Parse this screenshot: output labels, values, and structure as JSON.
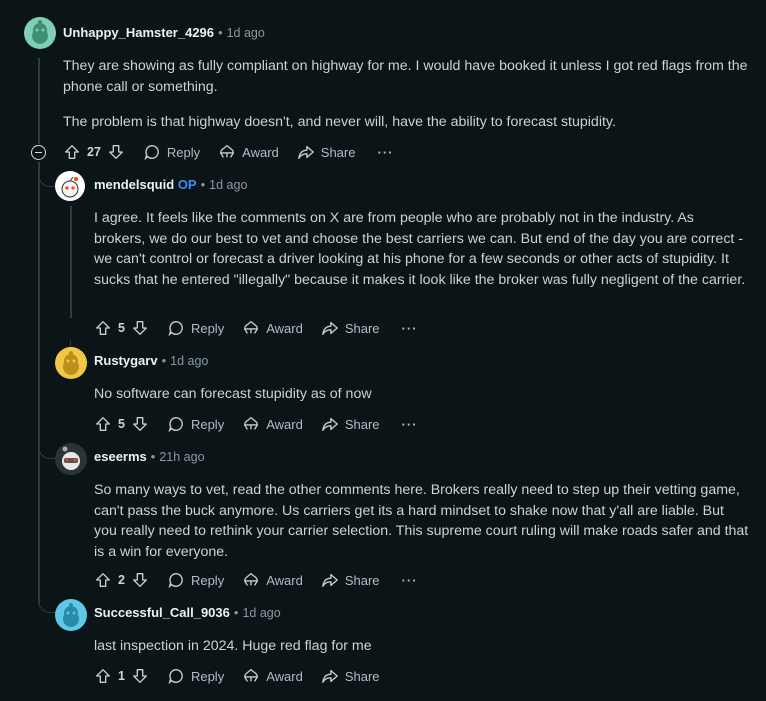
{
  "comments": [
    {
      "username": "Unhappy_Hamster_4296",
      "op": "",
      "time": "1d ago",
      "paragraphs": [
        "They are showing as fully compliant on highway for me. I would have booked it unless I got red flags from the phone call or something.",
        "The problem is that highway doesn't, and never will, have the ability to forecast stupidity."
      ],
      "votes": "27"
    },
    {
      "username": "mendelsquid",
      "op": "OP",
      "time": "1d ago",
      "paragraphs": [
        "I agree. It feels like the comments on X are from people who are probably not in the industry. As brokers, we do our best to vet and choose the best carriers we can. But end of the day you are correct - we can't control or forecast a driver looking at his phone for a few seconds or other acts of stupidity. It sucks that he entered \"illegally\" because it makes it look like the broker was fully negligent of the carrier."
      ],
      "votes": "5"
    },
    {
      "username": "Rustygarv",
      "op": "",
      "time": "1d ago",
      "paragraphs": [
        "No software can forecast stupidity as of now"
      ],
      "votes": "5"
    },
    {
      "username": "eseerms",
      "op": "",
      "time": "21h ago",
      "paragraphs": [
        "So many ways to vet, read the other comments here. Brokers really need to step up their vetting game, can't pass the buck anymore. Us carriers get its a hard mindset to shake now that y'all are liable. But you really need to rethink your carrier selection. This supreme court ruling will make roads safer and that is a win for everyone."
      ],
      "votes": "2"
    },
    {
      "username": "Successful_Call_9036",
      "op": "",
      "time": "1d ago",
      "paragraphs": [
        "last inspection in 2024. Huge red flag for me"
      ],
      "votes": "1"
    }
  ],
  "actions": {
    "reply": "Reply",
    "award": "Award",
    "share": "Share",
    "more": "···"
  },
  "colors": {
    "background": "#0b1416",
    "op_badge": "#3e8df4",
    "thread_line": "#2f3b40"
  }
}
